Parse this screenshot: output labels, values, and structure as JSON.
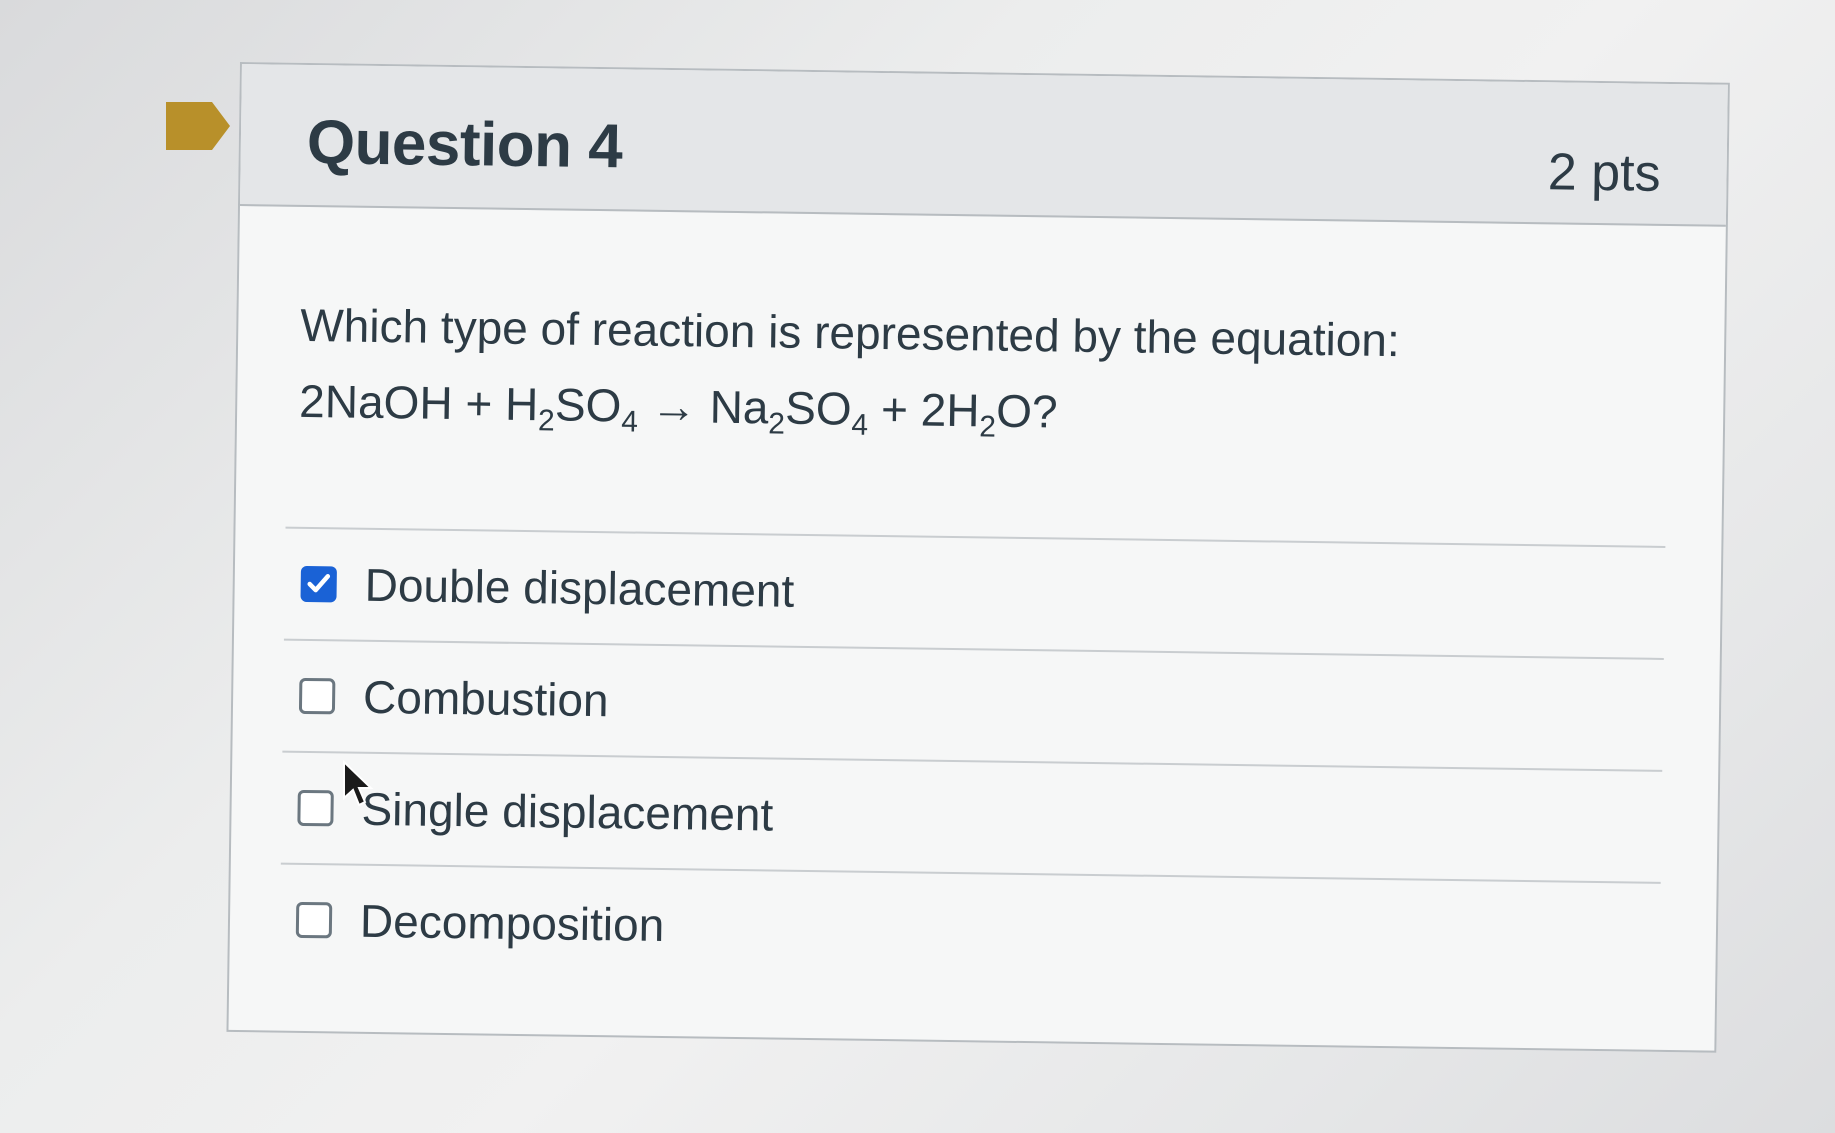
{
  "question": {
    "title": "Question 4",
    "points": "2 pts",
    "prompt_line1": "Which type of reaction is represented by the equation:",
    "equation": {
      "p1": "2NaOH + H",
      "s1": "2",
      "p2": "SO",
      "s2": "4",
      "p3": " → Na",
      "s3": "2",
      "p4": "SO",
      "s4": "4",
      "p5": " + 2H",
      "s5": "2",
      "p6": "O?"
    }
  },
  "answers": [
    {
      "label": "Double displacement",
      "checked": true
    },
    {
      "label": "Combustion",
      "checked": false
    },
    {
      "label": "Single displacement",
      "checked": false
    },
    {
      "label": "Decomposition",
      "checked": false
    }
  ],
  "colors": {
    "flag": "#b8902a",
    "checkbox_checked": "#1a62d6",
    "text": "#2d3b45"
  },
  "icons": {
    "flag": "bookmark-flag-icon",
    "check": "checkmark-icon",
    "cursor": "mouse-pointer-icon"
  }
}
